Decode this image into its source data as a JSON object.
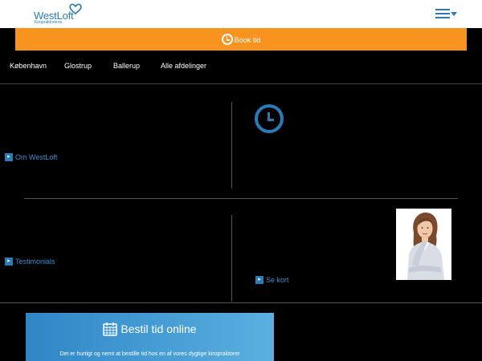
{
  "header": {
    "logo_name": "WestLoft",
    "logo_sub": "Kiropraktorerne",
    "menu_icon": "hamburger-menu-icon",
    "colors": {
      "brand": "#2a7cb8",
      "accent": "#f7931e"
    }
  },
  "book_bar": {
    "label": "Book tid",
    "icon": "clock-icon"
  },
  "nav": {
    "items": [
      {
        "label": "København"
      },
      {
        "label": "Glostrup"
      },
      {
        "label": "Ballerup"
      },
      {
        "label": "Alle afdelinger"
      }
    ]
  },
  "sections": {
    "about_link": "Om WestLoft",
    "testimonials_link": "Testimonials",
    "map_link": "Se kort",
    "clock_icon": "clock-icon",
    "portrait": "woman-portrait-image"
  },
  "cta": {
    "icon": "calendar-icon",
    "title": "Bestil tid online",
    "subtitle": "Det er hurtigt og nemt at bestille tid hos en af vores dygtige kiropraktorer"
  }
}
